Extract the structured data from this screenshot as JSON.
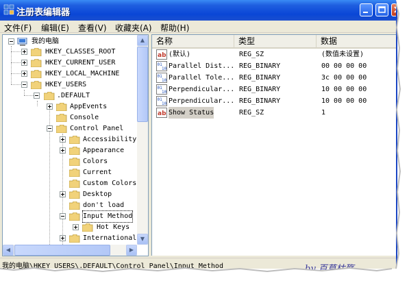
{
  "window": {
    "title": "注册表编辑器",
    "controls": {
      "minimize": "_",
      "maximize": "□",
      "close": "×"
    }
  },
  "menu": [
    "文件(F)",
    "编辑(E)",
    "查看(V)",
    "收藏夹(A)",
    "帮助(H)"
  ],
  "tree": {
    "root": "我的电脑",
    "hkcr": "HKEY_CLASSES_ROOT",
    "hkcu": "HKEY_CURRENT_USER",
    "hklm": "HKEY_LOCAL_MACHINE",
    "hku": "HKEY_USERS",
    "default": ".DEFAULT",
    "appevents": "AppEvents",
    "console": "Console",
    "control_panel": "Control Panel",
    "accessibility": "Accessibility",
    "appearance": "Appearance",
    "colors": "Colors",
    "current": "Current",
    "custom_colors": "Custom Colors",
    "desktop": "Desktop",
    "dont_load": "don't load",
    "input_method": "Input Method",
    "hot_keys": "Hot Keys",
    "international": "International"
  },
  "list": {
    "headers": {
      "name": "名称",
      "type": "类型",
      "data": "数据"
    },
    "rows": [
      {
        "name": "(默认)",
        "type": "REG_SZ",
        "data": "(数值未设置)",
        "icon": "string-value-icon"
      },
      {
        "name": "Parallel Dist...",
        "type": "REG_BINARY",
        "data": "00 00 00 00",
        "icon": "binary-value-icon"
      },
      {
        "name": "Parallel Tole...",
        "type": "REG_BINARY",
        "data": "3c 00 00 00",
        "icon": "binary-value-icon"
      },
      {
        "name": "Perpendicular...",
        "type": "REG_BINARY",
        "data": "10 00 00 00",
        "icon": "binary-value-icon"
      },
      {
        "name": "Perpendicular...",
        "type": "REG_BINARY",
        "data": "10 00 00 00",
        "icon": "binary-value-icon"
      },
      {
        "name": "Show Status",
        "type": "REG_SZ",
        "data": "1",
        "icon": "string-value-icon"
      }
    ]
  },
  "status": "我的电脑\\HKEY_USERS\\.DEFAULT\\Control Panel\\Input Method",
  "watermark": "by 百草枯殇",
  "colors": {
    "titlebar": "#0a46d6",
    "selection": "#d4d0c8",
    "pane_border": "#7f9db9"
  }
}
